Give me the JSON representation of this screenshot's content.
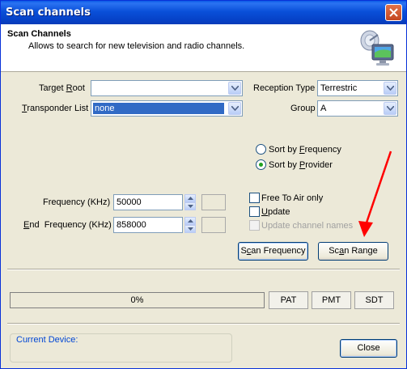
{
  "window": {
    "title": "Scan channels"
  },
  "header": {
    "title": "Scan Channels",
    "subtitle": "Allows to search for new television and radio channels."
  },
  "form": {
    "target_root": {
      "label_pre": "Target ",
      "label_u": "R",
      "label_post": "oot",
      "value": ""
    },
    "transponder_list": {
      "label_u": "T",
      "label_post": "ransponder List",
      "value": "none"
    },
    "reception_type": {
      "label": "Reception Type",
      "value": "Terrestric"
    },
    "group": {
      "label": "Group",
      "value": "A"
    },
    "sort_frequency": {
      "label_pre": "Sort by ",
      "label_u": "F",
      "label_post": "requency",
      "selected": false
    },
    "sort_provider": {
      "label_pre": "Sort by ",
      "label_u": "P",
      "label_post": "rovider",
      "selected": true
    },
    "frequency": {
      "label": "Frequency (KHz)",
      "value": "50000"
    },
    "end_frequency": {
      "label_u": "E",
      "label_post": "nd  Frequency (KHz)",
      "value": "858000"
    },
    "free_to_air": {
      "label": "Free To Air only",
      "checked": false
    },
    "update": {
      "label_u": "U",
      "label_post": "pdate",
      "checked": false
    },
    "update_names": {
      "label": "Update channel names",
      "checked": false,
      "disabled": true
    }
  },
  "buttons": {
    "scan_frequency": {
      "label_pre": "S",
      "label_u": "c",
      "label_post": "an Frequency"
    },
    "scan_range": {
      "label_pre": "Sc",
      "label_u": "a",
      "label_post": "n Range"
    },
    "pat": "PAT",
    "pmt": "PMT",
    "sdt": "SDT",
    "close": "Close"
  },
  "progress": {
    "text": "0%",
    "value": 0
  },
  "current_device": {
    "label": "Current Device:"
  },
  "colors": {
    "title_bar": "#0a50d9",
    "annotation_arrow": "#ff0000",
    "radio_dot": "#21a121"
  }
}
